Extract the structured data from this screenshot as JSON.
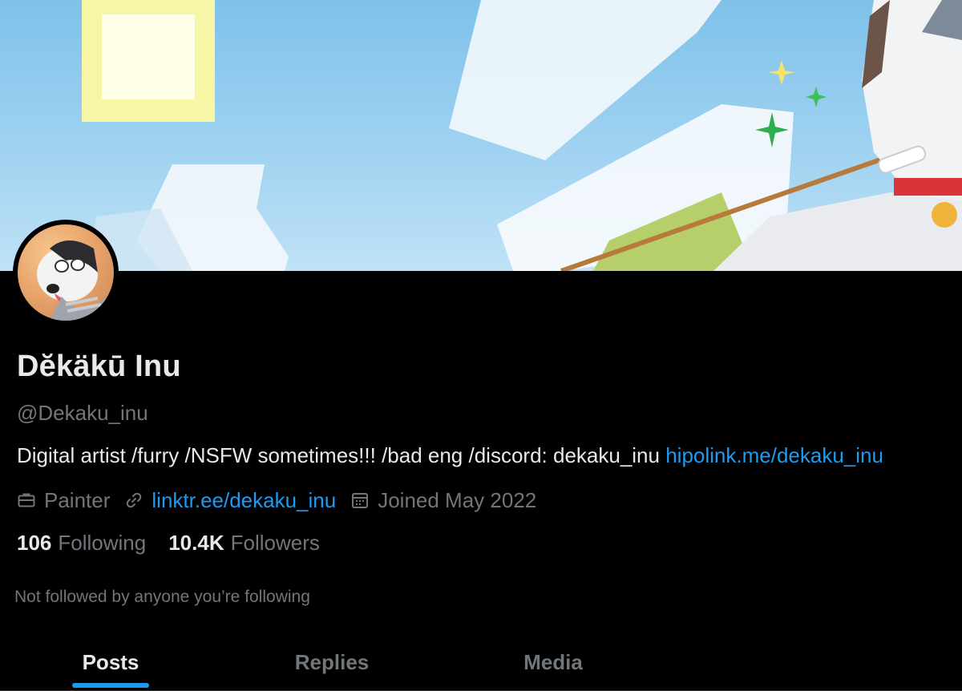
{
  "profile": {
    "display_name": "Dĕkäkū Inu",
    "handle": "@Dekaku_inu",
    "bio_text": "Digital artist /furry /NSFW sometimes!!! /bad eng /discord: dekaku_inu",
    "bio_link": "hipolink.me/dekaku_inu",
    "category": "Painter",
    "website": "linktr.ee/dekaku_inu",
    "joined": "Joined May 2022",
    "following_count": "106",
    "following_label": "Following",
    "followers_count": "10.4K",
    "followers_label": "Followers",
    "not_followed_text": "Not followed by anyone you’re following"
  },
  "tabs": [
    {
      "label": "Posts",
      "active": true
    },
    {
      "label": "Replies",
      "active": false
    },
    {
      "label": "Media",
      "active": false
    }
  ],
  "icons": {
    "category": "briefcase-icon",
    "website": "link-icon",
    "joined": "calendar-icon"
  },
  "colors": {
    "background": "#000000",
    "text_primary": "#e7e9ea",
    "text_secondary": "#71767b",
    "link": "#1d9bf0",
    "tab_indicator": "#1d9bf0"
  }
}
